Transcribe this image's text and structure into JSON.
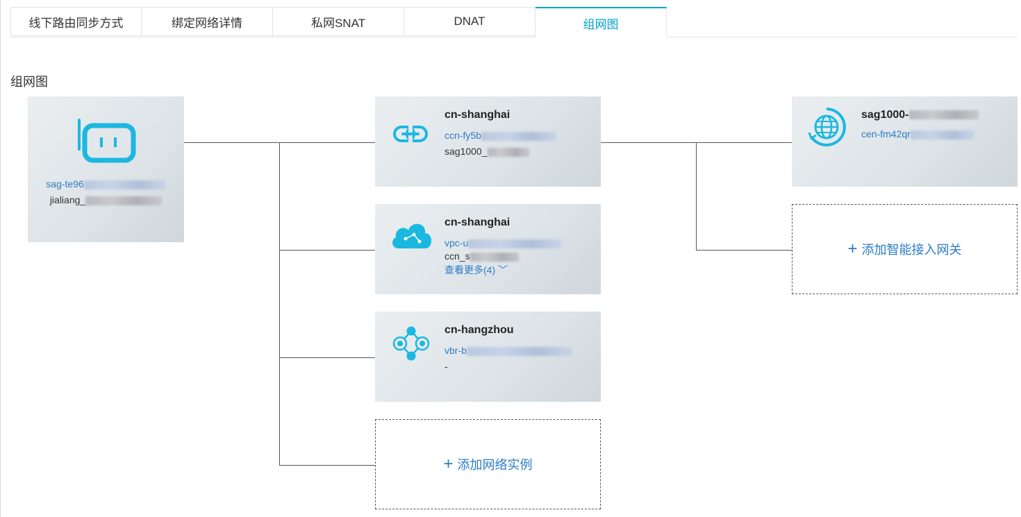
{
  "tabs": [
    {
      "label": "线下路由同步方式",
      "active": false
    },
    {
      "label": "绑定网络详情",
      "active": false
    },
    {
      "label": "私网SNAT",
      "active": false
    },
    {
      "label": "DNAT",
      "active": false
    },
    {
      "label": "组网图",
      "active": true
    }
  ],
  "section_title": "组网图",
  "sag": {
    "id_visible": "sag-te96",
    "name_visible": "jialiang_"
  },
  "networks": [
    {
      "region": "cn-shanghai",
      "id_visible": "ccn-fy5b",
      "sub_visible": "sag1000_",
      "icon": "ccn-link-icon"
    },
    {
      "region": "cn-shanghai",
      "id_visible": "vpc-u",
      "sub_visible": "ccn_s",
      "icon": "vpc-cloud-icon",
      "more": "查看更多(4)"
    },
    {
      "region": "cn-hangzhou",
      "id_visible": "vbr-b",
      "sub_visible": "-",
      "icon": "vbr-network-icon"
    }
  ],
  "add_network": {
    "plus": "+",
    "label": "添加网络实例"
  },
  "cen": {
    "name_visible": "sag1000-",
    "id_visible": "cen-fm42qr",
    "icon": "cen-globe-icon"
  },
  "add_gateway": {
    "plus": "+",
    "label": "添加智能接入网关"
  },
  "colors": {
    "accent": "#00a2ca",
    "link": "#2a7cc7",
    "icon": "#1ab8e0"
  }
}
